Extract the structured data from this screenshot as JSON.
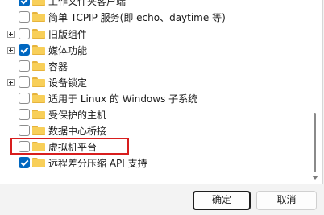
{
  "features": {
    "items": [
      {
        "label": "工作文件夹客户端",
        "checked": true,
        "expandable": false
      },
      {
        "label": "简单 TCPIP 服务(即 echo、daytime 等)",
        "checked": false,
        "expandable": false
      },
      {
        "label": "旧版组件",
        "checked": false,
        "expandable": true
      },
      {
        "label": "媒体功能",
        "checked": true,
        "expandable": true
      },
      {
        "label": "容器",
        "checked": false,
        "expandable": false
      },
      {
        "label": "设备锁定",
        "checked": false,
        "expandable": true
      },
      {
        "label": "适用于 Linux 的 Windows 子系统",
        "checked": false,
        "expandable": false
      },
      {
        "label": "受保护的主机",
        "checked": false,
        "expandable": false
      },
      {
        "label": "数据中心桥接",
        "checked": false,
        "expandable": false
      },
      {
        "label": "虚拟机平台",
        "checked": false,
        "expandable": false,
        "highlighted": true
      },
      {
        "label": "远程差分压缩 API 支持",
        "checked": true,
        "expandable": false
      }
    ]
  },
  "buttons": {
    "ok_label": "确定",
    "cancel_label": "取消"
  },
  "colors": {
    "accent": "#0067c0",
    "highlight_border": "#d81e1e",
    "folder": "#f8cf59"
  },
  "icons": {
    "folder": "folder-icon",
    "expander": "plus-expander-icon",
    "checkbox": "checkbox-icon"
  }
}
